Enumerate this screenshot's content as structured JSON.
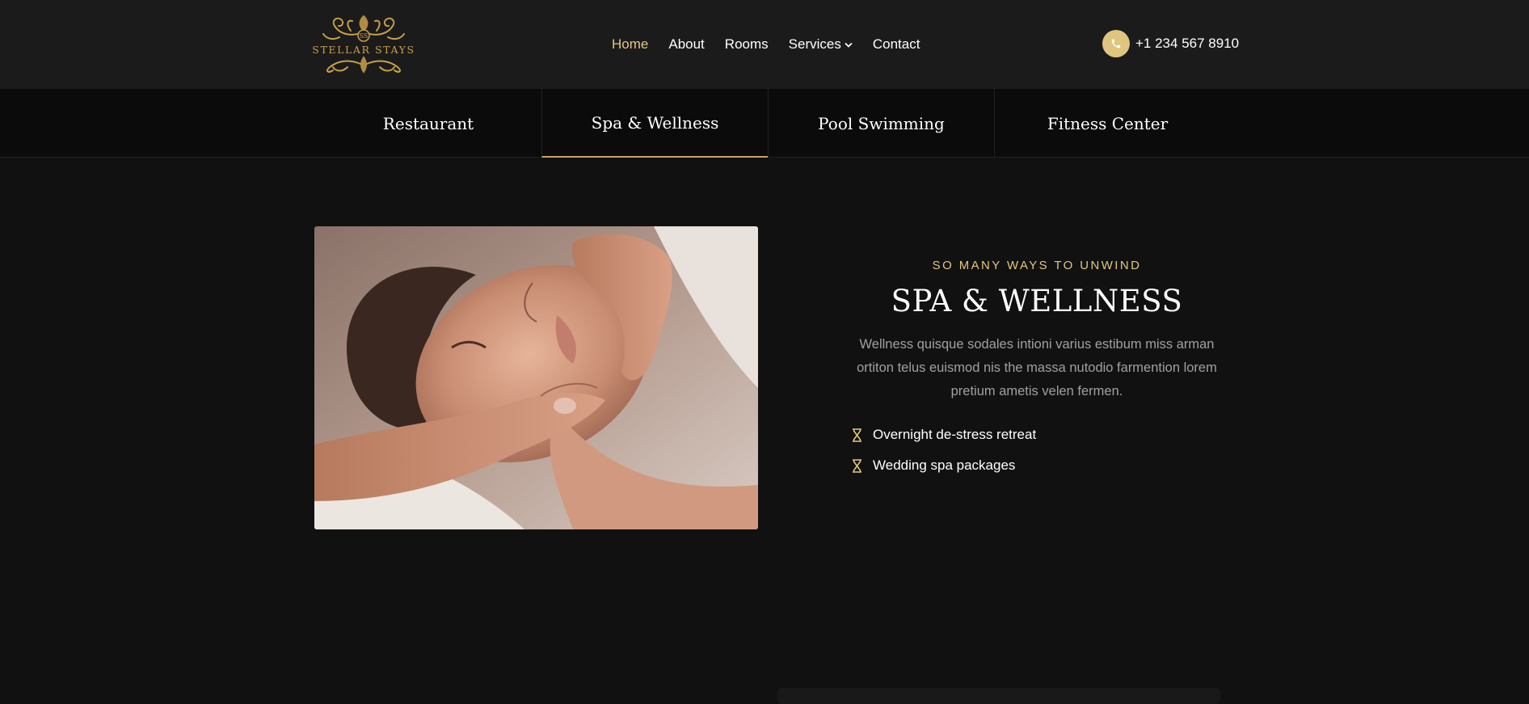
{
  "header": {
    "logo_text": "STELLAR STAYS",
    "logo_monogram": "SS",
    "nav": [
      {
        "label": "Home",
        "active": true
      },
      {
        "label": "About",
        "active": false
      },
      {
        "label": "Rooms",
        "active": false
      },
      {
        "label": "Services",
        "active": false,
        "has_dropdown": true
      },
      {
        "label": "Contact",
        "active": false
      }
    ],
    "phone": {
      "icon": "phone-icon",
      "number": "+1 234 567 8910"
    }
  },
  "tabs": [
    {
      "label": "Restaurant",
      "active": false
    },
    {
      "label": "Spa & Wellness",
      "active": true
    },
    {
      "label": "Pool Swimming",
      "active": false
    },
    {
      "label": "Fitness Center",
      "active": false
    }
  ],
  "section": {
    "eyebrow": "SO MANY WAYS TO UNWIND",
    "title": "SPA & WELLNESS",
    "description": "Wellness quisque sodales intioni varius estibum miss arman ortiton telus euismod nis the massa nutodio farmention lorem pretium ametis velen fermen.",
    "features": [
      {
        "icon": "hourglass-icon",
        "label": "Overnight de-stress retreat"
      },
      {
        "icon": "hourglass-icon",
        "label": "Wedding spa packages"
      }
    ]
  },
  "colors": {
    "accent": "#e3c77e",
    "gold": "#c9a04a",
    "header_bg": "#1b1b1b",
    "tabs_bg": "#0b0b0b",
    "page_bg": "#111111",
    "muted_text": "#a0a0a0"
  }
}
